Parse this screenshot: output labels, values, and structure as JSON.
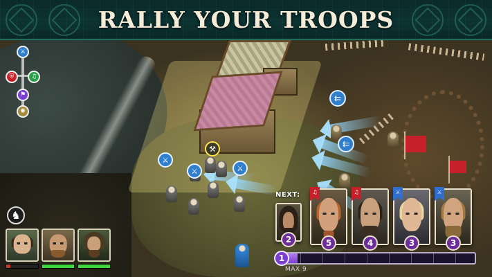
{
  "banner": {
    "title": "RALLY YOUR TROOPS"
  },
  "order_wheel": {
    "icons": [
      "sword-icon",
      "shield-icon",
      "horn-icon",
      "banner-icon",
      "rune-icon"
    ]
  },
  "map_markers": [
    "sword-icon",
    "sword-icon",
    "sword-icon",
    "spear-icon",
    "spear-icon",
    "axe-icon"
  ],
  "cavalry_button": {
    "icon": "horse-icon"
  },
  "squad": [
    {
      "name": "warrior-woman",
      "health": 0.12,
      "health_color": "#c83a2a"
    },
    {
      "name": "bearded-warrior",
      "health": 1.0,
      "health_color": "#3ed63a"
    },
    {
      "name": "hooded-archer",
      "health": 1.0,
      "health_color": "#3ed63a"
    }
  ],
  "deck": {
    "next_label": "NEXT:",
    "next_card": {
      "cost": "2"
    },
    "cards": [
      {
        "cost": "5",
        "tag_color": "#c8202a",
        "tag_icon": "horn-icon"
      },
      {
        "cost": "4",
        "tag_color": "#c8202a",
        "tag_icon": "horn-icon"
      },
      {
        "cost": "3",
        "tag_color": "#2f6fce",
        "tag_icon": "sword-icon"
      },
      {
        "cost": "3",
        "tag_color": "#2f6fce",
        "tag_icon": "sword-icon"
      }
    ]
  },
  "energy": {
    "value": "1",
    "max_label": "MAX 9",
    "fill": 0.1
  },
  "colors": {
    "accent": "#1c6f5a",
    "energy": "#7a3fd0",
    "order_blue": "#2f7fce"
  }
}
